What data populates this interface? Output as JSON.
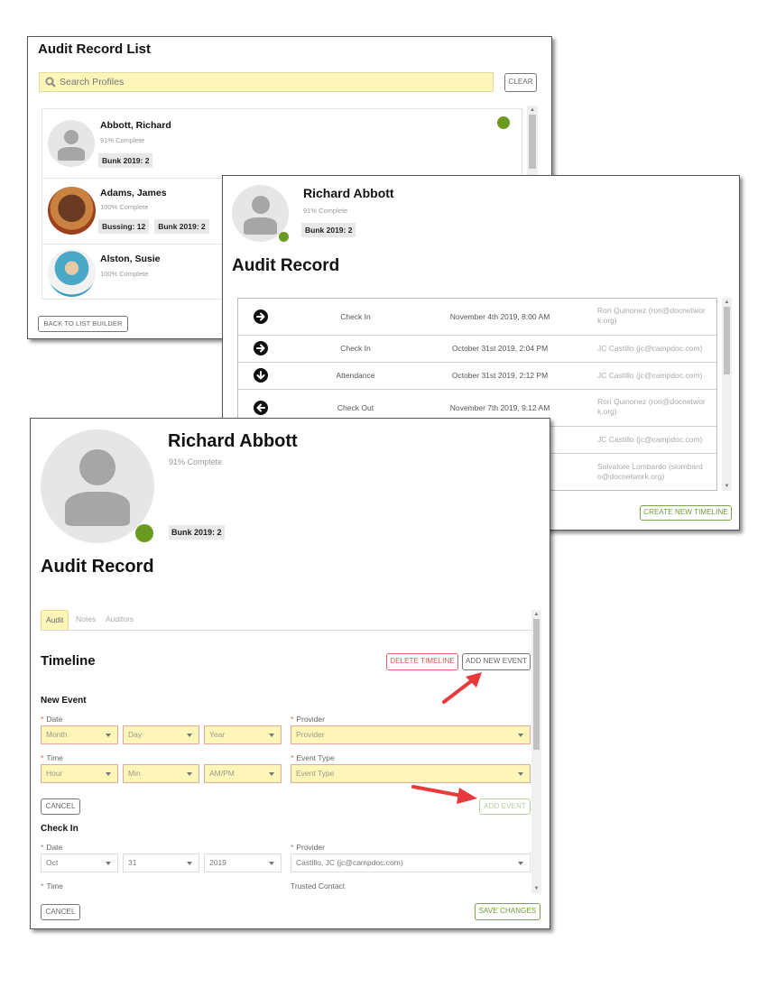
{
  "list_window": {
    "title": "Audit Record List",
    "search": {
      "placeholder": "Search Profiles",
      "value": ""
    },
    "clear_label": "CLEAR",
    "profiles": [
      {
        "name": "Abbott, Richard",
        "completion": "91% Complete",
        "tags": [
          "Bunk 2019: 2"
        ],
        "status": "online",
        "avatar": "placeholder"
      },
      {
        "name": "Adams, James",
        "completion": "100% Complete",
        "tags": [
          "Bussing: 12",
          "Bunk 2019: 2"
        ],
        "avatar": "photo"
      },
      {
        "name": "Alston, Susie",
        "completion": "100% Complete",
        "tags": [],
        "avatar": "photo"
      }
    ],
    "back_label": "BACK TO LIST BUILDER"
  },
  "record_window": {
    "name": "Richard Abbott",
    "completion": "91% Complete",
    "tag": "Bunk 2019: 2",
    "heading": "Audit Record",
    "events": [
      {
        "icon": "arrow-right-circle-icon",
        "type": "Check In",
        "datetime": "November 4th 2019, 8:00 AM",
        "by": "Rori Quinonez (rori@docnetwor k.org)"
      },
      {
        "icon": "arrow-right-circle-icon",
        "type": "Check In",
        "datetime": "October 31st 2019, 2:04 PM",
        "by": "JC Castillo (jc@campdoc.com)"
      },
      {
        "icon": "arrow-down-circle-icon",
        "type": "Attendance",
        "datetime": "October 31st 2019, 2:12 PM",
        "by": "JC Castillo (jc@campdoc.com)"
      },
      {
        "icon": "arrow-left-circle-icon",
        "type": "Check Out",
        "datetime": "November 7th 2019, 9:12 AM",
        "by": "Rori Quinonez (rori@docnetwor k.org)"
      },
      {
        "icon": "",
        "type": "",
        "datetime": "",
        "by": "JC Castillo (jc@campdoc.com)"
      },
      {
        "icon": "",
        "type": "",
        "datetime": "",
        "by": "Salvatore Lombardo (slombard o@docnetwork.org)"
      }
    ],
    "create_label": "CREATE NEW TIMELINE"
  },
  "detail_window": {
    "name": "Richard Abbott",
    "completion": "91% Complete",
    "tag": "Bunk 2019: 2",
    "heading": "Audit Record",
    "tabs": [
      {
        "label": "Audit",
        "active": true
      },
      {
        "label": "Notes",
        "active": false
      },
      {
        "label": "Auditors",
        "active": false
      }
    ],
    "timeline_heading": "Timeline",
    "delete_label": "DELETE TIMELINE",
    "add_new_label": "ADD NEW EVENT",
    "new_event": {
      "heading": "New Event",
      "date_label": "Date",
      "month_placeholder": "Month",
      "day_placeholder": "Day",
      "year_placeholder": "Year",
      "time_label": "Time",
      "hour_placeholder": "Hour",
      "min_placeholder": "Min",
      "ampm_placeholder": "AM/PM",
      "provider_label": "Provider",
      "provider_placeholder": "Provider",
      "event_type_label": "Event Type",
      "event_type_placeholder": "Event Type",
      "cancel_label": "CANCEL",
      "add_label": "ADD EVENT"
    },
    "check_in": {
      "heading": "Check In",
      "date_label": "Date",
      "month": "Oct",
      "day": "31",
      "year": "2019",
      "provider_label": "Provider",
      "provider": "Castillo, JC (jc@campdoc.com)",
      "time_label": "Time",
      "trusted_label": "Trusted Contact",
      "cancel_label": "CANCEL"
    },
    "save_label": "SAVE CHANGES"
  },
  "colors": {
    "accent_green": "#6a9a1f",
    "highlight_yellow": "#fdf6b8",
    "danger_red": "#d9534f",
    "annotation_arrow": "#e8393d"
  }
}
